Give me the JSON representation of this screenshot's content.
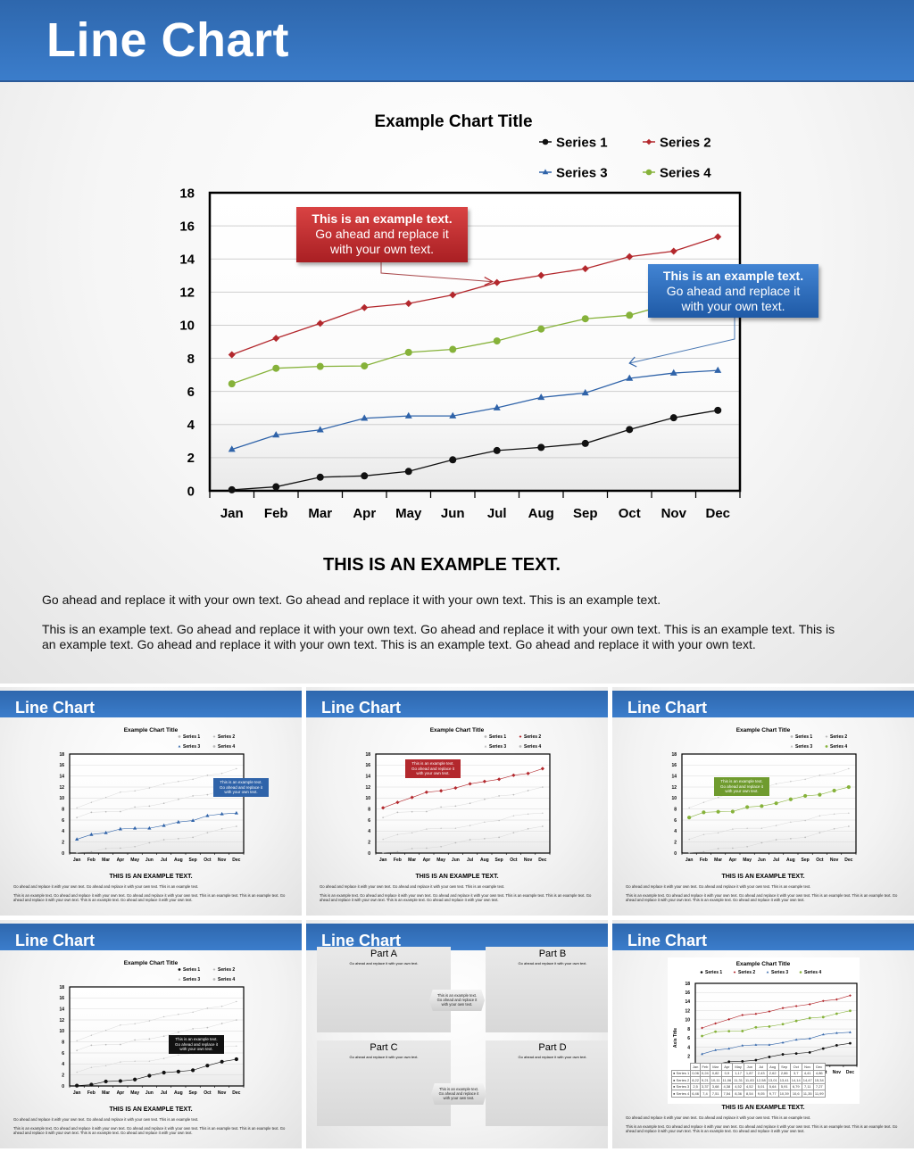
{
  "header": {
    "title": "Line Chart"
  },
  "chart_data": {
    "type": "line",
    "title": "Example Chart Title",
    "categories": [
      "Jan",
      "Feb",
      "Mar",
      "Apr",
      "May",
      "Jun",
      "Jul",
      "Aug",
      "Sep",
      "Oct",
      "Nov",
      "Dec"
    ],
    "series": [
      {
        "name": "Series 1",
        "color": "#111111",
        "marker": "circle",
        "values": [
          0.06,
          0.24,
          0.82,
          0.9,
          1.17,
          1.87,
          2.43,
          2.62,
          2.86,
          3.7,
          4.41,
          4.86
        ]
      },
      {
        "name": "Series 2",
        "color": "#b3282d",
        "marker": "diamond",
        "values": [
          8.22,
          9.21,
          10.11,
          11.06,
          11.31,
          11.83,
          12.58,
          13.01,
          13.41,
          14.14,
          14.47,
          15.34
        ]
      },
      {
        "name": "Series 3",
        "color": "#2f63a9",
        "marker": "triangle",
        "values": [
          2.5,
          3.37,
          3.68,
          4.38,
          4.52,
          4.52,
          5.01,
          5.64,
          5.91,
          6.79,
          7.11,
          7.27
        ]
      },
      {
        "name": "Series 4",
        "color": "#86b23a",
        "marker": "circle",
        "values": [
          6.46,
          7.4,
          7.51,
          7.54,
          8.36,
          8.54,
          9.05,
          9.77,
          10.39,
          10.6,
          11.35,
          11.99
        ]
      }
    ],
    "ylim": [
      0,
      18
    ],
    "yticks": [
      0,
      2,
      4,
      6,
      8,
      10,
      12,
      14,
      16,
      18
    ],
    "xlabel": "",
    "ylabel": "",
    "grid": true,
    "legend": "top-right",
    "annotations": [
      {
        "lines": [
          "This is an example text.",
          "Go ahead and replace it",
          "with your own text."
        ],
        "color": "#b3282d",
        "points_to": {
          "series": "Series 2",
          "category": "Jul"
        }
      },
      {
        "lines": [
          "This is an example text.",
          "Go ahead and replace it",
          "with your own text."
        ],
        "color": "#2f63a9",
        "points_to": {
          "series": "Series 3",
          "category": "Oct"
        }
      }
    ]
  },
  "body": {
    "heading": "THIS IS AN EXAMPLE TEXT.",
    "paragraph1": "Go ahead and replace it with your own text. Go ahead and replace it with your own text. This is an example text.",
    "paragraph2": "This is an example text. Go ahead and replace it with your own text. Go ahead and replace it with your own text. This is an example text. This is an example text. Go ahead and replace it with your own text. This is an example text. Go ahead and replace it with your own text."
  },
  "callout_text": {
    "line1": "This is an example text.",
    "line2": "Go ahead and replace it",
    "line3": "with your own text."
  },
  "thumbnails": [
    {
      "title": "Line Chart",
      "variant": "highlight-series-3",
      "callout_color": "#2f63a9"
    },
    {
      "title": "Line Chart",
      "variant": "highlight-series-2",
      "callout_color": "#b3282d"
    },
    {
      "title": "Line Chart",
      "variant": "highlight-series-4",
      "callout_color": "#6f9b2e"
    },
    {
      "title": "Line Chart",
      "variant": "highlight-series-1",
      "callout_color": "#111111"
    },
    {
      "title": "Line Chart",
      "variant": "four-parts",
      "parts": [
        {
          "label": "Part A",
          "subtitle": "Go ahead and replace it with your own text.",
          "highlight": "Series 3"
        },
        {
          "label": "Part B",
          "subtitle": "Go ahead and replace it with your own text.",
          "highlight": "Series 2"
        },
        {
          "label": "Part C",
          "subtitle": "Go ahead and replace it with your own text.",
          "highlight": "Series 4"
        },
        {
          "label": "Part D",
          "subtitle": "Go ahead and replace it with your own text.",
          "highlight": "Series 1"
        }
      ]
    },
    {
      "title": "Line Chart",
      "variant": "data-table",
      "axis_title": "Axis Title"
    }
  ]
}
